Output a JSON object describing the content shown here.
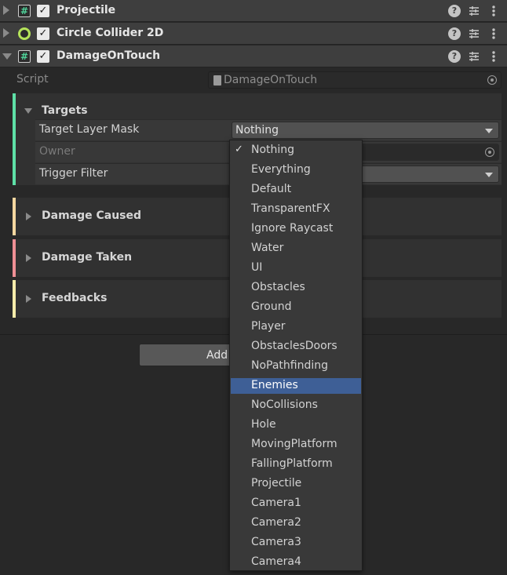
{
  "components": [
    {
      "title": "Projectile",
      "icon": "script-hash-icon",
      "enabled": true,
      "expanded": false
    },
    {
      "title": "Circle Collider 2D",
      "icon": "circle-collider-icon",
      "enabled": true,
      "expanded": false
    },
    {
      "title": "DamageOnTouch",
      "icon": "script-hash-icon",
      "enabled": true,
      "expanded": true
    }
  ],
  "header_buttons": {
    "help": "?",
    "check": "✓"
  },
  "script_row": {
    "label": "Script",
    "value": "DamageOnTouch"
  },
  "sections": {
    "targets": {
      "title": "Targets",
      "bar_color": "#5ee0a7"
    },
    "damage_caused": {
      "title": "Damage Caused",
      "bar_color": "#f5d7a0"
    },
    "damage_taken": {
      "title": "Damage Taken",
      "bar_color": "#ef8f95"
    },
    "feedbacks": {
      "title": "Feedbacks",
      "bar_color": "#f7ecaa"
    }
  },
  "properties": {
    "target_layer_mask": {
      "label": "Target Layer Mask",
      "value": "Nothing"
    },
    "owner": {
      "label": "Owner"
    },
    "trigger_filter": {
      "label": "Trigger Filter"
    }
  },
  "add_component_button": {
    "label": "Add"
  },
  "layer_dropdown": {
    "selected": "Nothing",
    "highlighted": "Enemies",
    "check_mark": "✓",
    "highlight_color": "#3e5f96",
    "options": [
      "Nothing",
      "Everything",
      "Default",
      "TransparentFX",
      "Ignore Raycast",
      "Water",
      "UI",
      "Obstacles",
      "Ground",
      "Player",
      "ObstaclesDoors",
      "NoPathfinding",
      "Enemies",
      "NoCollisions",
      "Hole",
      "MovingPlatform",
      "FallingPlatform",
      "Projectile",
      "Camera1",
      "Camera2",
      "Camera3",
      "Camera4"
    ]
  }
}
